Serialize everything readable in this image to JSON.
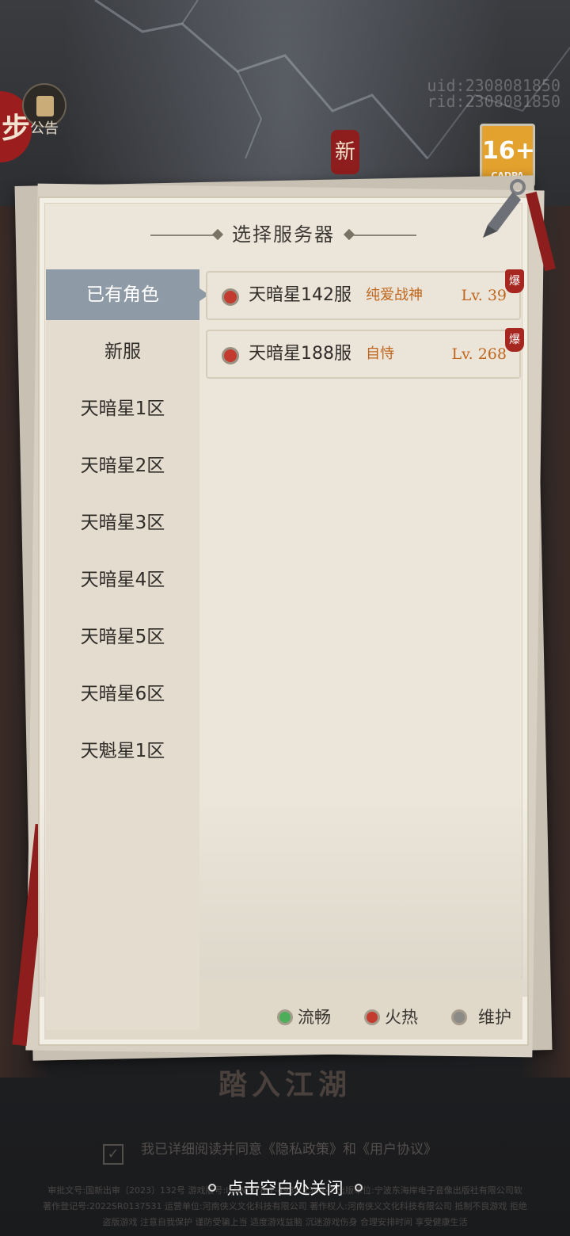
{
  "uid_lines": [
    "uid:2308081850",
    "rid:2308081850"
  ],
  "notice_label": "公告",
  "logo_char": "步",
  "age_badge": {
    "rating": "16+",
    "org": "CADPA"
  },
  "new_seal": "新",
  "dialog": {
    "title": "选择服务器",
    "tabs": [
      {
        "label": "已有角色",
        "active": true
      },
      {
        "label": "新服",
        "active": false
      },
      {
        "label": "天暗星1区",
        "active": false
      },
      {
        "label": "天暗星2区",
        "active": false
      },
      {
        "label": "天暗星3区",
        "active": false
      },
      {
        "label": "天暗星4区",
        "active": false
      },
      {
        "label": "天暗星5区",
        "active": false
      },
      {
        "label": "天暗星6区",
        "active": false
      },
      {
        "label": "天魁星1区",
        "active": false
      }
    ],
    "servers": [
      {
        "name": "天暗星142服",
        "role": "纯爱战神",
        "level": "Lv. 39",
        "badge": "爆",
        "status": "hot"
      },
      {
        "name": "天暗星188服",
        "role": "自恃",
        "level": "Lv. 268",
        "badge": "爆",
        "status": "hot"
      }
    ],
    "legend": [
      {
        "label": "流畅",
        "color": "#4cae5b"
      },
      {
        "label": "火热",
        "color": "#c33a2f"
      },
      {
        "label": "维护",
        "color": "#8c8a86"
      }
    ]
  },
  "enter_button": "踏入江湖",
  "agreement": {
    "prefix": "我已详细阅读并同意",
    "privacy": "《隐私政策》",
    "and": "和",
    "terms": "《用户协议》"
  },
  "close_hint": "点击空白处关闭",
  "legal_lines": [
    "审批文号:国新出审〔2023〕132号 游戏版号:ISBN 978-7-498-12344-3 出版单位:宁波东海岸电子音像出版社有限公司软",
    "著作登记号:2022SR0137531 运营单位:河南侠义文化科技有限公司 著作权人:河南侠义文化科技有限公司 抵制不良游戏 拒绝",
    "盗版游戏 注意自我保护 谨防受骗上当 适度游戏益脑 沉迷游戏伤身 合理安排时间 享受健康生活"
  ]
}
